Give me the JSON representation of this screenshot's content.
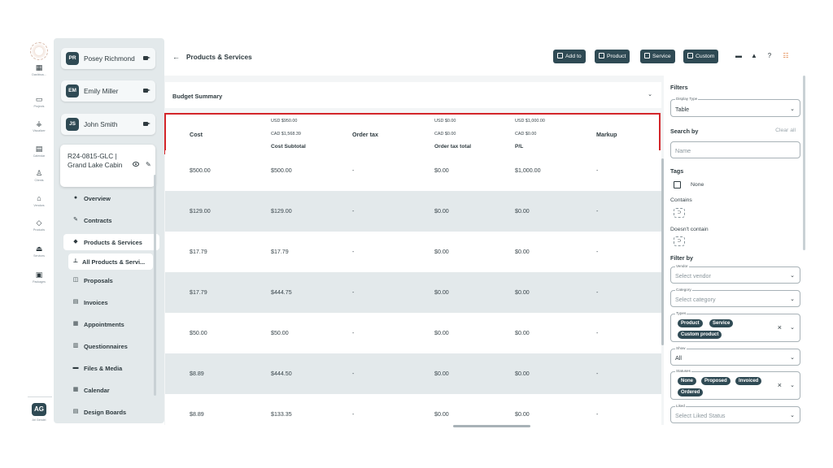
{
  "rail": {
    "items": [
      {
        "label": "Dashboa...",
        "icon": "grid-icon",
        "glyph": "▦"
      },
      {
        "label": "Projects",
        "icon": "folder-icon",
        "glyph": "▭"
      },
      {
        "label": "Visualizer",
        "icon": "visualizer-icon",
        "glyph": "⚶"
      },
      {
        "label": "Calendar",
        "icon": "calendar-icon",
        "glyph": "▤"
      },
      {
        "label": "Clients",
        "icon": "person-icon",
        "glyph": "♙"
      },
      {
        "label": "Vendors",
        "icon": "store-icon",
        "glyph": "⌂"
      },
      {
        "label": "Products",
        "icon": "tag-icon",
        "glyph": "◇"
      },
      {
        "label": "Services",
        "icon": "service-icon",
        "glyph": "⏏"
      },
      {
        "label": "Packages",
        "icon": "package-icon",
        "glyph": "▣"
      }
    ],
    "avatar": "AG",
    "avatar_label": "Ari Gendel"
  },
  "clients": [
    {
      "initials": "PR",
      "name": "Posey Richmond"
    },
    {
      "initials": "EM",
      "name": "Emily Miller"
    },
    {
      "initials": "JS",
      "name": "John Smith"
    }
  ],
  "project": {
    "title": "R24-0815-GLC | Grand Lake Cabin"
  },
  "nav": [
    {
      "label": "Overview",
      "glyph": "●",
      "icon": "info-icon"
    },
    {
      "label": "Contracts",
      "glyph": "✎",
      "icon": "contract-icon"
    },
    {
      "label": "Products & Services",
      "glyph": "◆",
      "icon": "tag-icon"
    },
    {
      "label": "All Products & Servi...",
      "glyph": "⊥",
      "icon": "pin-icon"
    },
    {
      "label": "Proposals",
      "glyph": "◫",
      "icon": "proposal-icon"
    },
    {
      "label": "Invoices",
      "glyph": "▤",
      "icon": "invoice-icon"
    },
    {
      "label": "Appointments",
      "glyph": "▦",
      "icon": "appointment-icon"
    },
    {
      "label": "Questionnaires",
      "glyph": "▥",
      "icon": "questionnaire-icon"
    },
    {
      "label": "Files & Media",
      "glyph": "▬",
      "icon": "files-icon"
    },
    {
      "label": "Calendar",
      "glyph": "▦",
      "icon": "calendar-icon"
    },
    {
      "label": "Design Boards",
      "glyph": "▤",
      "icon": "board-icon"
    }
  ],
  "header": {
    "back": "←",
    "title": "Products & Services",
    "buttons": [
      "Add to",
      "Product",
      "Service",
      "Custom"
    ]
  },
  "budget": {
    "title": "Budget Summary",
    "summary": {
      "cost_label": "Cost",
      "cost_usd": "USD $950.00",
      "cost_cad": "CAD $1,568.39",
      "cost_subtotal": "Cost Subtotal",
      "order_tax": "Order tax",
      "tax_usd": "USD $0.00",
      "tax_cad": "CAD $0.00",
      "order_tax_total": "Order tax total",
      "pl_usd": "USD $1,000.00",
      "pl_cad": "CAD $0.00",
      "pl": "P/L",
      "markup": "Markup"
    },
    "rows": [
      [
        "$500.00",
        "$500.00",
        "-",
        "$0.00",
        "$1,000.00",
        "-"
      ],
      [
        "$129.00",
        "$129.00",
        "-",
        "$0.00",
        "$0.00",
        "-"
      ],
      [
        "$17.79",
        "$17.79",
        "-",
        "$0.00",
        "$0.00",
        "-"
      ],
      [
        "$17.79",
        "$444.75",
        "-",
        "$0.00",
        "$0.00",
        "-"
      ],
      [
        "$50.00",
        "$50.00",
        "-",
        "$0.00",
        "$0.00",
        "-"
      ],
      [
        "$8.89",
        "$444.50",
        "-",
        "$0.00",
        "$0.00",
        "-"
      ],
      [
        "$8.89",
        "$133.35",
        "-",
        "$0.00",
        "$0.00",
        "-"
      ]
    ]
  },
  "filters": {
    "title": "Filters",
    "display_type": {
      "legend": "Display Type",
      "value": "Table"
    },
    "search_by": "Search by",
    "clear_all": "Clear all",
    "name_placeholder": "Name",
    "tags": "Tags",
    "none": "None",
    "contains": "Contains",
    "doesnt_contain": "Doesn't contain",
    "filter_by": "Filter by",
    "vendor": {
      "legend": "Vendor",
      "placeholder": "Select vendor"
    },
    "category": {
      "legend": "Category",
      "placeholder": "Select category"
    },
    "types": {
      "legend": "Types",
      "chips": [
        "Product",
        "Service",
        "Custom product"
      ]
    },
    "show": {
      "legend": "Show",
      "value": "All"
    },
    "statuses": {
      "legend": "Statuses",
      "chips": [
        "None",
        "Proposed",
        "Invoiced",
        "Ordered"
      ]
    },
    "liked": {
      "legend": "Liked",
      "placeholder": "Select Liked Status"
    }
  }
}
